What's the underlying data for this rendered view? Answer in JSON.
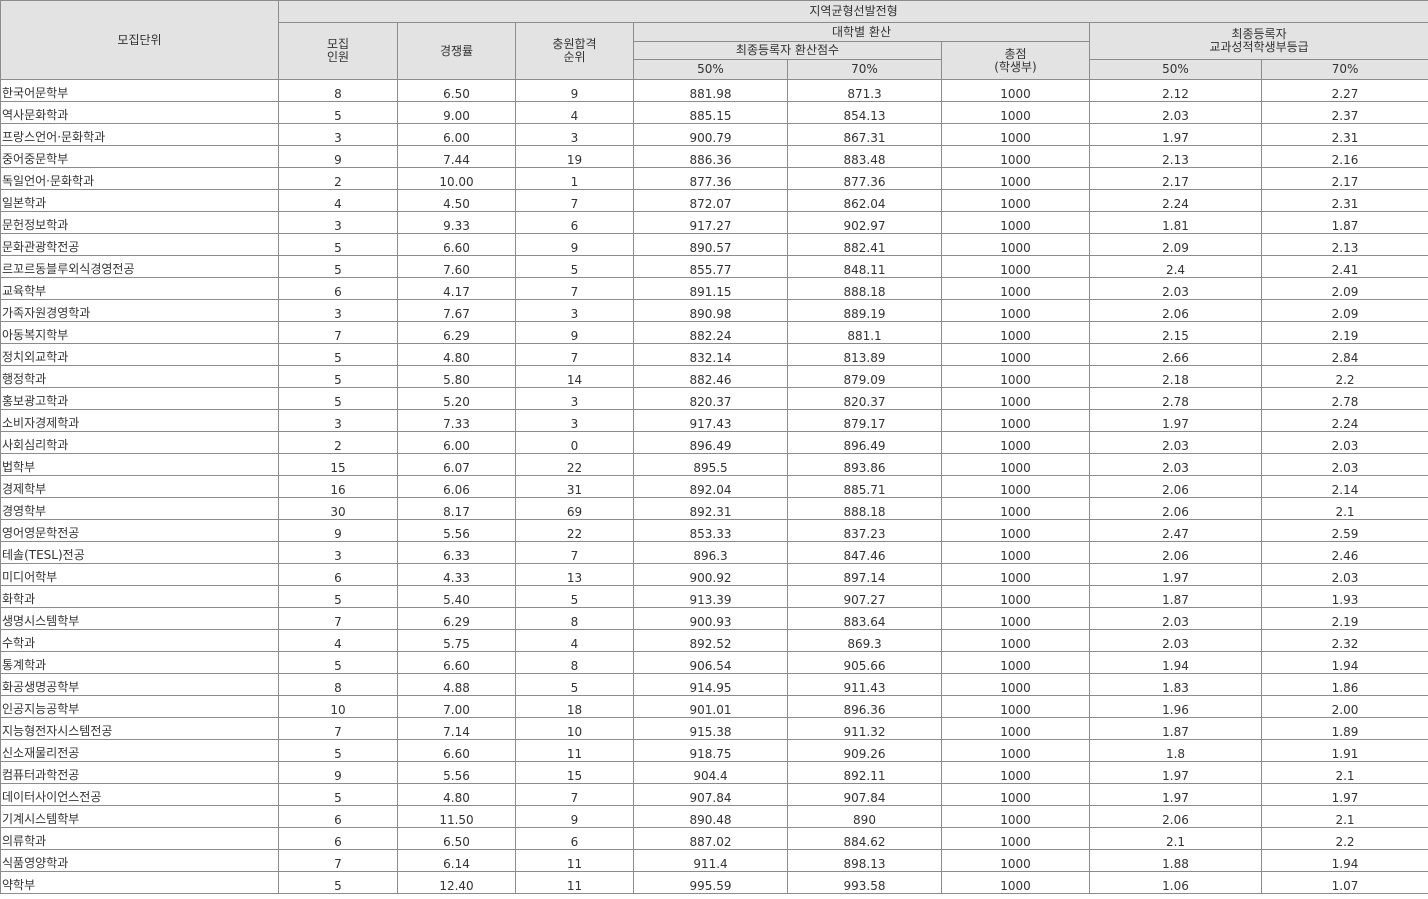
{
  "header": {
    "unit": "모집단위",
    "group": "지역균형선발전형",
    "quota": "모집\n인원",
    "competition": "경쟁률",
    "waitlist": "충원합격\n순위",
    "univ_conv": "대학별 환산",
    "final_conv_score": "최종등록자 환산점수",
    "total": "총점\n(학생부)",
    "final_grade": "최종등록자\n교과성적학생부등급",
    "p50": "50%",
    "p70": "70%"
  },
  "rows": [
    {
      "name": "한국어문학부",
      "quota": "8",
      "rate": "6.50",
      "rank": "9",
      "s50": "881.98",
      "s70": "871.3",
      "total": "1000",
      "g50": "2.12",
      "g70": "2.27"
    },
    {
      "name": "역사문화학과",
      "quota": "5",
      "rate": "9.00",
      "rank": "4",
      "s50": "885.15",
      "s70": "854.13",
      "total": "1000",
      "g50": "2.03",
      "g70": "2.37"
    },
    {
      "name": "프랑스언어·문화학과",
      "quota": "3",
      "rate": "6.00",
      "rank": "3",
      "s50": "900.79",
      "s70": "867.31",
      "total": "1000",
      "g50": "1.97",
      "g70": "2.31"
    },
    {
      "name": "중어중문학부",
      "quota": "9",
      "rate": "7.44",
      "rank": "19",
      "s50": "886.36",
      "s70": "883.48",
      "total": "1000",
      "g50": "2.13",
      "g70": "2.16"
    },
    {
      "name": "독일언어·문화학과",
      "quota": "2",
      "rate": "10.00",
      "rank": "1",
      "s50": "877.36",
      "s70": "877.36",
      "total": "1000",
      "g50": "2.17",
      "g70": "2.17"
    },
    {
      "name": "일본학과",
      "quota": "4",
      "rate": "4.50",
      "rank": "7",
      "s50": "872.07",
      "s70": "862.04",
      "total": "1000",
      "g50": "2.24",
      "g70": "2.31"
    },
    {
      "name": "문헌정보학과",
      "quota": "3",
      "rate": "9.33",
      "rank": "6",
      "s50": "917.27",
      "s70": "902.97",
      "total": "1000",
      "g50": "1.81",
      "g70": "1.87"
    },
    {
      "name": "문화관광학전공",
      "quota": "5",
      "rate": "6.60",
      "rank": "9",
      "s50": "890.57",
      "s70": "882.41",
      "total": "1000",
      "g50": "2.09",
      "g70": "2.13"
    },
    {
      "name": "르꼬르동블루외식경영전공",
      "quota": "5",
      "rate": "7.60",
      "rank": "5",
      "s50": "855.77",
      "s70": "848.11",
      "total": "1000",
      "g50": "2.4",
      "g70": "2.41"
    },
    {
      "name": "교육학부",
      "quota": "6",
      "rate": "4.17",
      "rank": "7",
      "s50": "891.15",
      "s70": "888.18",
      "total": "1000",
      "g50": "2.03",
      "g70": "2.09"
    },
    {
      "name": "가족자원경영학과",
      "quota": "3",
      "rate": "7.67",
      "rank": "3",
      "s50": "890.98",
      "s70": "889.19",
      "total": "1000",
      "g50": "2.06",
      "g70": "2.09"
    },
    {
      "name": "아동복지학부",
      "quota": "7",
      "rate": "6.29",
      "rank": "9",
      "s50": "882.24",
      "s70": "881.1",
      "total": "1000",
      "g50": "2.15",
      "g70": "2.19"
    },
    {
      "name": "정치외교학과",
      "quota": "5",
      "rate": "4.80",
      "rank": "7",
      "s50": "832.14",
      "s70": "813.89",
      "total": "1000",
      "g50": "2.66",
      "g70": "2.84"
    },
    {
      "name": "행정학과",
      "quota": "5",
      "rate": "5.80",
      "rank": "14",
      "s50": "882.46",
      "s70": "879.09",
      "total": "1000",
      "g50": "2.18",
      "g70": "2.2"
    },
    {
      "name": "홍보광고학과",
      "quota": "5",
      "rate": "5.20",
      "rank": "3",
      "s50": "820.37",
      "s70": "820.37",
      "total": "1000",
      "g50": "2.78",
      "g70": "2.78"
    },
    {
      "name": "소비자경제학과",
      "quota": "3",
      "rate": "7.33",
      "rank": "3",
      "s50": "917.43",
      "s70": "879.17",
      "total": "1000",
      "g50": "1.97",
      "g70": "2.24"
    },
    {
      "name": "사회심리학과",
      "quota": "2",
      "rate": "6.00",
      "rank": "0",
      "s50": "896.49",
      "s70": "896.49",
      "total": "1000",
      "g50": "2.03",
      "g70": "2.03"
    },
    {
      "name": "법학부",
      "quota": "15",
      "rate": "6.07",
      "rank": "22",
      "s50": "895.5",
      "s70": "893.86",
      "total": "1000",
      "g50": "2.03",
      "g70": "2.03"
    },
    {
      "name": "경제학부",
      "quota": "16",
      "rate": "6.06",
      "rank": "31",
      "s50": "892.04",
      "s70": "885.71",
      "total": "1000",
      "g50": "2.06",
      "g70": "2.14"
    },
    {
      "name": "경영학부",
      "quota": "30",
      "rate": "8.17",
      "rank": "69",
      "s50": "892.31",
      "s70": "888.18",
      "total": "1000",
      "g50": "2.06",
      "g70": "2.1"
    },
    {
      "name": "영어영문학전공",
      "quota": "9",
      "rate": "5.56",
      "rank": "22",
      "s50": "853.33",
      "s70": "837.23",
      "total": "1000",
      "g50": "2.47",
      "g70": "2.59"
    },
    {
      "name": "테솔(TESL)전공",
      "quota": "3",
      "rate": "6.33",
      "rank": "7",
      "s50": "896.3",
      "s70": "847.46",
      "total": "1000",
      "g50": "2.06",
      "g70": "2.46"
    },
    {
      "name": "미디어학부",
      "quota": "6",
      "rate": "4.33",
      "rank": "13",
      "s50": "900.92",
      "s70": "897.14",
      "total": "1000",
      "g50": "1.97",
      "g70": "2.03"
    },
    {
      "name": "화학과",
      "quota": "5",
      "rate": "5.40",
      "rank": "5",
      "s50": "913.39",
      "s70": "907.27",
      "total": "1000",
      "g50": "1.87",
      "g70": "1.93"
    },
    {
      "name": "생명시스템학부",
      "quota": "7",
      "rate": "6.29",
      "rank": "8",
      "s50": "900.93",
      "s70": "883.64",
      "total": "1000",
      "g50": "2.03",
      "g70": "2.19"
    },
    {
      "name": "수학과",
      "quota": "4",
      "rate": "5.75",
      "rank": "4",
      "s50": "892.52",
      "s70": "869.3",
      "total": "1000",
      "g50": "2.03",
      "g70": "2.32"
    },
    {
      "name": "통계학과",
      "quota": "5",
      "rate": "6.60",
      "rank": "8",
      "s50": "906.54",
      "s70": "905.66",
      "total": "1000",
      "g50": "1.94",
      "g70": "1.94"
    },
    {
      "name": "화공생명공학부",
      "quota": "8",
      "rate": "4.88",
      "rank": "5",
      "s50": "914.95",
      "s70": "911.43",
      "total": "1000",
      "g50": "1.83",
      "g70": "1.86"
    },
    {
      "name": "인공지능공학부",
      "quota": "10",
      "rate": "7.00",
      "rank": "18",
      "s50": "901.01",
      "s70": "896.36",
      "total": "1000",
      "g50": "1.96",
      "g70": "2.00"
    },
    {
      "name": "지능형전자시스템전공",
      "quota": "7",
      "rate": "7.14",
      "rank": "10",
      "s50": "915.38",
      "s70": "911.32",
      "total": "1000",
      "g50": "1.87",
      "g70": "1.89"
    },
    {
      "name": "신소재물리전공",
      "quota": "5",
      "rate": "6.60",
      "rank": "11",
      "s50": "918.75",
      "s70": "909.26",
      "total": "1000",
      "g50": "1.8",
      "g70": "1.91"
    },
    {
      "name": "컴퓨터과학전공",
      "quota": "9",
      "rate": "5.56",
      "rank": "15",
      "s50": "904.4",
      "s70": "892.11",
      "total": "1000",
      "g50": "1.97",
      "g70": "2.1"
    },
    {
      "name": "데이터사이언스전공",
      "quota": "5",
      "rate": "4.80",
      "rank": "7",
      "s50": "907.84",
      "s70": "907.84",
      "total": "1000",
      "g50": "1.97",
      "g70": "1.97"
    },
    {
      "name": "기계시스템학부",
      "quota": "6",
      "rate": "11.50",
      "rank": "9",
      "s50": "890.48",
      "s70": "890",
      "total": "1000",
      "g50": "2.06",
      "g70": "2.1"
    },
    {
      "name": "의류학과",
      "quota": "6",
      "rate": "6.50",
      "rank": "6",
      "s50": "887.02",
      "s70": "884.62",
      "total": "1000",
      "g50": "2.1",
      "g70": "2.2"
    },
    {
      "name": "식품영양학과",
      "quota": "7",
      "rate": "6.14",
      "rank": "11",
      "s50": "911.4",
      "s70": "898.13",
      "total": "1000",
      "g50": "1.88",
      "g70": "1.94"
    },
    {
      "name": "약학부",
      "quota": "5",
      "rate": "12.40",
      "rank": "11",
      "s50": "995.59",
      "s70": "993.58",
      "total": "1000",
      "g50": "1.06",
      "g70": "1.07"
    }
  ]
}
